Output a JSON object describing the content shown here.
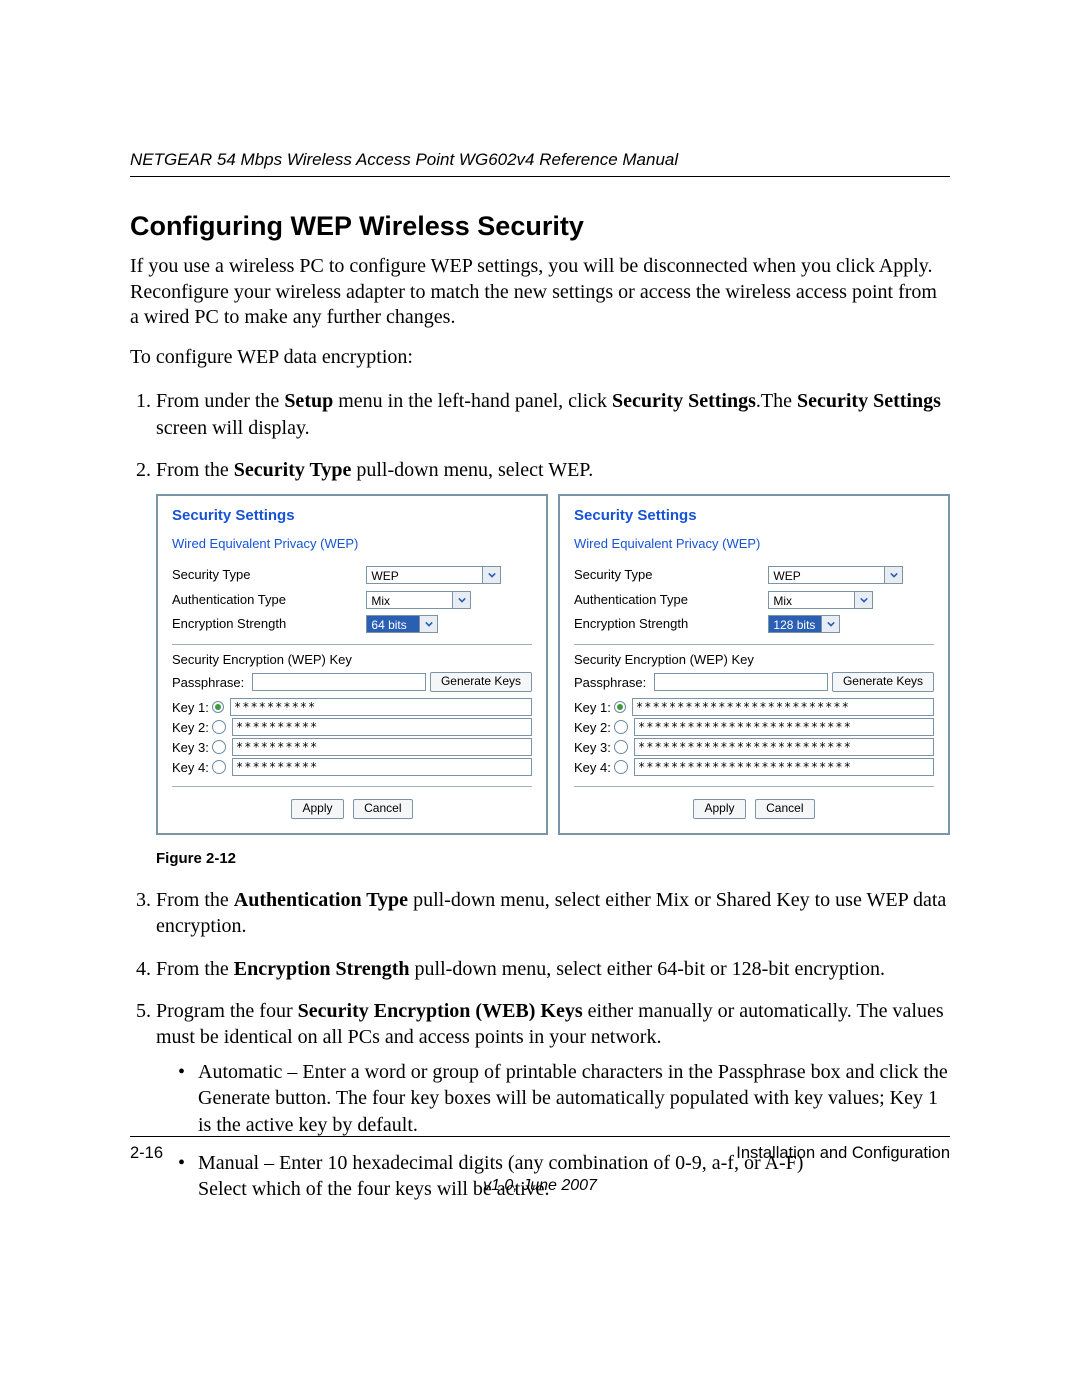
{
  "header": {
    "running": "NETGEAR 54 Mbps Wireless Access Point WG602v4 Reference Manual"
  },
  "heading": "Configuring WEP Wireless Security",
  "intro": "If you use a wireless PC to configure WEP settings, you will be disconnected when you click Apply. Reconfigure your wireless adapter to match the new settings or access the wireless access point from a wired PC to make any further changes.",
  "lead": "To configure WEP data encryption:",
  "steps": {
    "s1a": "From under the ",
    "s1b": "Setup",
    "s1c": " menu in the left-hand panel, click ",
    "s1d": "Security Settings",
    "s1e": ".The ",
    "s1f": "Security Settings",
    "s1g": " screen will display.",
    "s2a": "From the ",
    "s2b": "Security Type",
    "s2c": " pull-down menu, select WEP.",
    "s3a": "From the ",
    "s3b": "Authentication Type",
    "s3c": " pull-down menu, select either Mix or Shared Key to use WEP data encryption.",
    "s4a": "From the ",
    "s4b": "Encryption Strength",
    "s4c": " pull-down menu, select either 64-bit or 128-bit encryption.",
    "s5a": "Program the four ",
    "s5b": "Security Encryption (WEB) Keys",
    "s5c": " either manually or automatically. The values must be identical on all PCs and access points in your network.",
    "s5_b1": "Automatic – Enter a word or group of printable characters in the Passphrase box and click the Generate button. The four key boxes will be automatically populated with key values; Key 1 is the active key by default.",
    "s5_b2a": "Manual – Enter 10 hexadecimal digits (any combination of 0-9, a-f, or A-F)",
    "s5_b2b": "Select which of the four keys will be active."
  },
  "fig": {
    "caption": "Figure 2-12",
    "panel_title": "Security Settings",
    "panel_subtitle": "Wired Equivalent Privacy (WEP)",
    "labels": {
      "sec_type": "Security Type",
      "auth_type": "Authentication Type",
      "enc_strength": "Encryption Strength",
      "wep_key": "Security Encryption (WEP) Key",
      "passphrase": "Passphrase:",
      "gen": "Generate Keys",
      "k1": "Key 1:",
      "k2": "Key 2:",
      "k3": "Key 3:",
      "k4": "Key 4:",
      "apply": "Apply",
      "cancel": "Cancel"
    },
    "left": {
      "sec_type": "WEP",
      "auth_type": "Mix",
      "enc": "64 bits",
      "mask": "**********"
    },
    "right": {
      "sec_type": "WEP",
      "auth_type": "Mix",
      "enc": "128 bits",
      "mask": "**************************"
    }
  },
  "footer": {
    "pageno": "2-16",
    "section": "Installation and Configuration",
    "version": "v1.0, June 2007"
  }
}
